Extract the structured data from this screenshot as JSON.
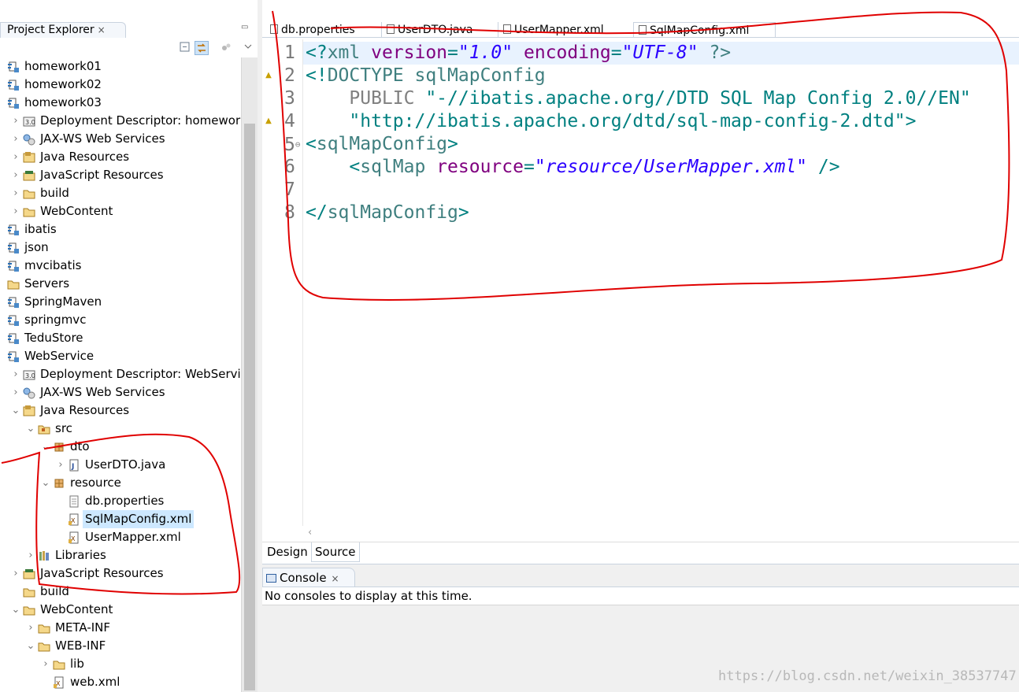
{
  "explorer": {
    "title": "Project Explorer",
    "close_glyph": "×",
    "minimize_glyph": "▭",
    "toolbar": [
      "collapse-all-icon",
      "link-with-editor-icon",
      "filter-icon",
      "view-menu-icon"
    ],
    "rows": [
      {
        "label": "homework01",
        "indent": 0,
        "chevron": "",
        "icon": "project"
      },
      {
        "label": "homework02",
        "indent": 0,
        "chevron": "",
        "icon": "project"
      },
      {
        "label": "homework03",
        "indent": 0,
        "chevron": "",
        "icon": "project"
      },
      {
        "label": "Deployment Descriptor: homework",
        "indent": 1,
        "chevron": "›",
        "icon": "descriptor"
      },
      {
        "label": "JAX-WS Web Services",
        "indent": 1,
        "chevron": "›",
        "icon": "webservice"
      },
      {
        "label": "Java Resources",
        "indent": 1,
        "chevron": "›",
        "icon": "javares"
      },
      {
        "label": "JavaScript Resources",
        "indent": 1,
        "chevron": "›",
        "icon": "jsres"
      },
      {
        "label": "build",
        "indent": 1,
        "chevron": "›",
        "icon": "folder"
      },
      {
        "label": "WebContent",
        "indent": 1,
        "chevron": "›",
        "icon": "folder"
      },
      {
        "label": "ibatis",
        "indent": 0,
        "chevron": "",
        "icon": "project"
      },
      {
        "label": "json",
        "indent": 0,
        "chevron": "",
        "icon": "project"
      },
      {
        "label": "mvcibatis",
        "indent": 0,
        "chevron": "",
        "icon": "project"
      },
      {
        "label": "Servers",
        "indent": 0,
        "chevron": "",
        "icon": "folder"
      },
      {
        "label": "SpringMaven",
        "indent": 0,
        "chevron": "",
        "icon": "project"
      },
      {
        "label": "springmvc",
        "indent": 0,
        "chevron": "",
        "icon": "project"
      },
      {
        "label": "TeduStore",
        "indent": 0,
        "chevron": "",
        "icon": "project"
      },
      {
        "label": "WebService",
        "indent": 0,
        "chevron": "",
        "icon": "project"
      },
      {
        "label": "Deployment Descriptor: WebServic",
        "indent": 1,
        "chevron": "›",
        "icon": "descriptor"
      },
      {
        "label": "JAX-WS Web Services",
        "indent": 1,
        "chevron": "›",
        "icon": "webservice"
      },
      {
        "label": "Java Resources",
        "indent": 1,
        "chevron": "⌄",
        "icon": "javares"
      },
      {
        "label": "src",
        "indent": 2,
        "chevron": "⌄",
        "icon": "srcfolder"
      },
      {
        "label": "dto",
        "indent": 3,
        "chevron": "⌄",
        "icon": "package"
      },
      {
        "label": "UserDTO.java",
        "indent": 4,
        "chevron": "›",
        "icon": "javafile"
      },
      {
        "label": "resource",
        "indent": 3,
        "chevron": "⌄",
        "icon": "package"
      },
      {
        "label": "db.properties",
        "indent": 4,
        "chevron": "",
        "icon": "textfile"
      },
      {
        "label": "SqlMapConfig.xml",
        "indent": 4,
        "chevron": "",
        "icon": "xmlfile",
        "selected": true
      },
      {
        "label": "UserMapper.xml",
        "indent": 4,
        "chevron": "",
        "icon": "xmlfile"
      },
      {
        "label": "Libraries",
        "indent": 2,
        "chevron": "›",
        "icon": "library"
      },
      {
        "label": "JavaScript Resources",
        "indent": 1,
        "chevron": "›",
        "icon": "jsres"
      },
      {
        "label": "build",
        "indent": 1,
        "chevron": "",
        "icon": "folder"
      },
      {
        "label": "WebContent",
        "indent": 1,
        "chevron": "⌄",
        "icon": "folder"
      },
      {
        "label": "META-INF",
        "indent": 2,
        "chevron": "›",
        "icon": "folder"
      },
      {
        "label": "WEB-INF",
        "indent": 2,
        "chevron": "⌄",
        "icon": "folder"
      },
      {
        "label": "lib",
        "indent": 3,
        "chevron": "›",
        "icon": "folder"
      },
      {
        "label": "web.xml",
        "indent": 3,
        "chevron": "",
        "icon": "xmlfile"
      }
    ]
  },
  "editor": {
    "tabs": [
      {
        "label": "db.properties",
        "active": false
      },
      {
        "label": "UserDTO.java",
        "active": false
      },
      {
        "label": "UserMapper.xml",
        "active": false
      },
      {
        "label": "SqlMapConfig.xml",
        "active": true
      }
    ],
    "warning_lines": [
      2,
      4
    ],
    "fold_lines": [
      5
    ],
    "lines": [
      {
        "n": "1",
        "tokens": [
          [
            "br",
            "<?"
          ],
          [
            "tag",
            "xml "
          ],
          [
            "att",
            "version"
          ],
          [
            "br",
            "="
          ],
          [
            "str",
            "\"1.0\""
          ],
          [
            "br",
            " "
          ],
          [
            "att",
            "encoding"
          ],
          [
            "br",
            "="
          ],
          [
            "str",
            "\"UTF-8\""
          ],
          [
            "br",
            " "
          ],
          [
            "tag",
            "?>"
          ]
        ]
      },
      {
        "n": "2",
        "tokens": [
          [
            "br",
            "<!"
          ],
          [
            "tag",
            "DOCTYPE "
          ],
          [
            "tag",
            "sqlMapConfig"
          ]
        ]
      },
      {
        "n": "3",
        "tokens": [
          [
            "ph",
            "    "
          ],
          [
            "dtd",
            "PUBLIC "
          ],
          [
            "dstr",
            "\"-//ibatis.apache.org//DTD SQL Map Config 2.0//EN\""
          ]
        ]
      },
      {
        "n": "4",
        "tokens": [
          [
            "ph",
            "    "
          ],
          [
            "dstr",
            "\"http://ibatis.apache.org/dtd/sql-map-config-2.dtd\""
          ],
          [
            "br",
            ">"
          ]
        ]
      },
      {
        "n": "5",
        "tokens": [
          [
            "br",
            "<"
          ],
          [
            "tag",
            "sqlMapConfig"
          ],
          [
            "br",
            ">"
          ]
        ]
      },
      {
        "n": "6",
        "tokens": [
          [
            "ph",
            "    "
          ],
          [
            "br",
            "<"
          ],
          [
            "tag",
            "sqlMap "
          ],
          [
            "att",
            "resource"
          ],
          [
            "br",
            "="
          ],
          [
            "str",
            "\"resource/UserMapper.xml\""
          ],
          [
            "br",
            " />"
          ]
        ]
      },
      {
        "n": "7",
        "tokens": []
      },
      {
        "n": "8",
        "tokens": [
          [
            "br",
            "</"
          ],
          [
            "tag",
            "sqlMapConfig"
          ],
          [
            "br",
            ">"
          ]
        ]
      }
    ],
    "h_scroll_glyph": "‹",
    "mode_tabs": [
      {
        "label": "Design",
        "active": false
      },
      {
        "label": "Source",
        "active": true
      }
    ]
  },
  "console": {
    "tab_label": "Console",
    "close_glyph": "×",
    "message": "No consoles to display at this time."
  },
  "watermark": "https://blog.csdn.net/weixin_38537747",
  "colors": {
    "annotation": "#e00000",
    "selection": "#cde8ff"
  }
}
